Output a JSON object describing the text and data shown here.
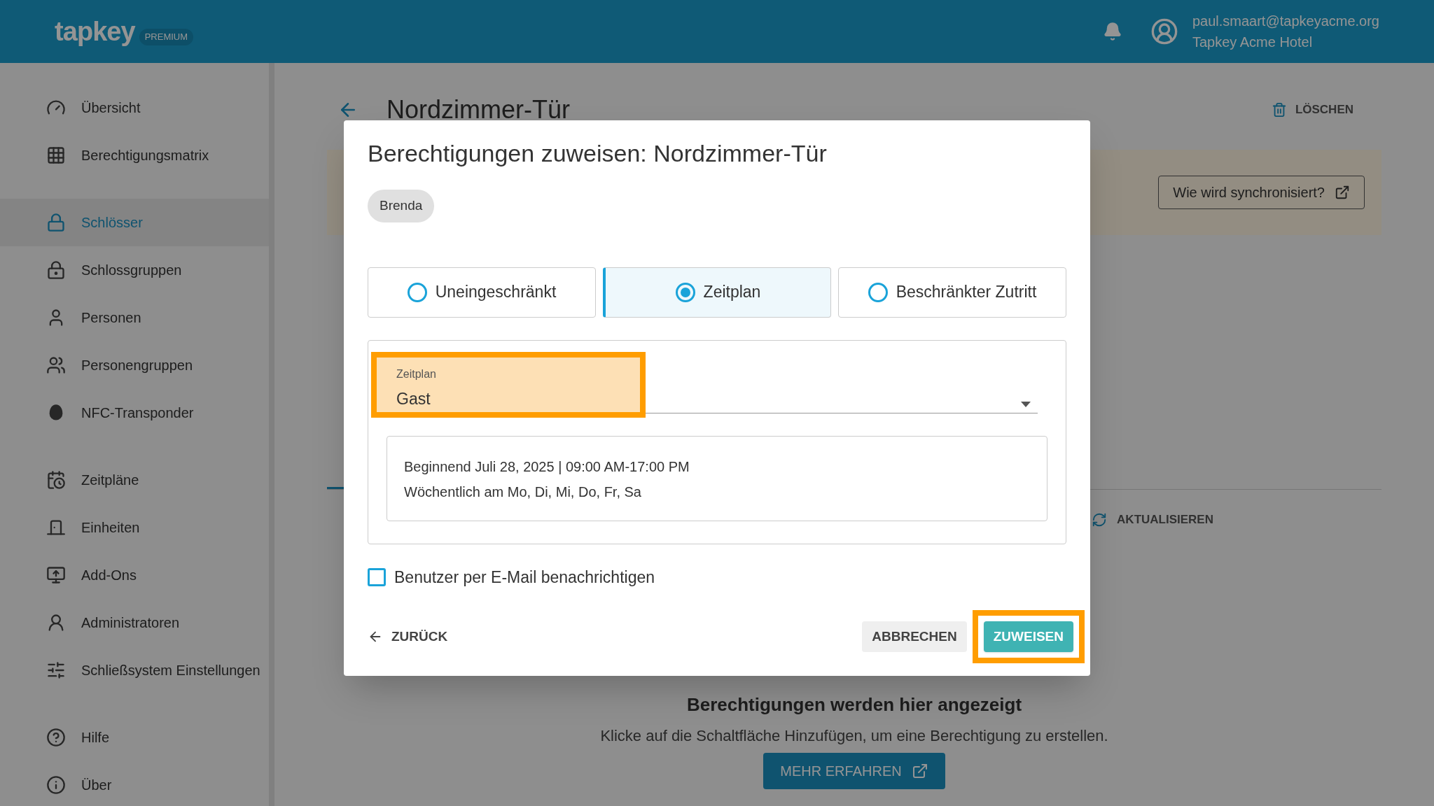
{
  "header": {
    "logo": "tapkey",
    "badge": "PREMIUM",
    "user_email": "paul.smaart@tapkeyacme.org",
    "organization": "Tapkey Acme Hotel"
  },
  "sidebar": {
    "groups": [
      [
        {
          "label": "Übersicht",
          "selected": false
        },
        {
          "label": "Berechtigungsmatrix",
          "selected": false
        }
      ],
      [
        {
          "label": "Schlösser",
          "selected": true
        },
        {
          "label": "Schlossgruppen",
          "selected": false
        },
        {
          "label": "Personen",
          "selected": false
        },
        {
          "label": "Personengruppen",
          "selected": false
        },
        {
          "label": "NFC-Transponder",
          "selected": false
        }
      ],
      [
        {
          "label": "Zeitpläne",
          "selected": false
        },
        {
          "label": "Einheiten",
          "selected": false
        },
        {
          "label": "Add-Ons",
          "selected": false
        },
        {
          "label": "Administratoren",
          "selected": false
        },
        {
          "label": "Schließsystem Einstellungen",
          "selected": false
        }
      ],
      [
        {
          "label": "Hilfe",
          "selected": false
        },
        {
          "label": "Über",
          "selected": false
        }
      ]
    ]
  },
  "page": {
    "title": "Nordzimmer-Tür",
    "delete_button": "LÖSCHEN",
    "sync_button": "Wie wird synchronisiert?",
    "refresh_button": "AKTUALISIEREN",
    "empty_title": "Berechtigungen werden hier angezeigt",
    "empty_text": "Klicke auf die Schaltfläche Hinzufügen, um eine Berechtigung zu erstellen.",
    "learn_more_button": "MEHR ERFAHREN"
  },
  "dialog": {
    "title": "Berechtigungen zuweisen: Nordzimmer-Tür",
    "chip": "Brenda",
    "access_types": [
      {
        "label": "Uneingeschränkt",
        "selected": false
      },
      {
        "label": "Zeitplan",
        "selected": true
      },
      {
        "label": "Beschränkter Zutritt",
        "selected": false
      }
    ],
    "schedule_field": {
      "label": "Zeitplan",
      "value": "Gast",
      "highlighted": true
    },
    "schedule_summary": [
      "Beginnend Juli 28, 2025 | 09:00 AM-17:00 PM",
      "Wöchentlich am Mo, Di, Mi, Do, Fr, Sa"
    ],
    "notify": {
      "label": "Benutzer per E-Mail benachrichtigen",
      "checked": false
    },
    "back_button": "ZURÜCK",
    "cancel_button": "ABBRECHEN",
    "assign_button": {
      "label": "ZUWEISEN",
      "highlighted": true
    }
  }
}
